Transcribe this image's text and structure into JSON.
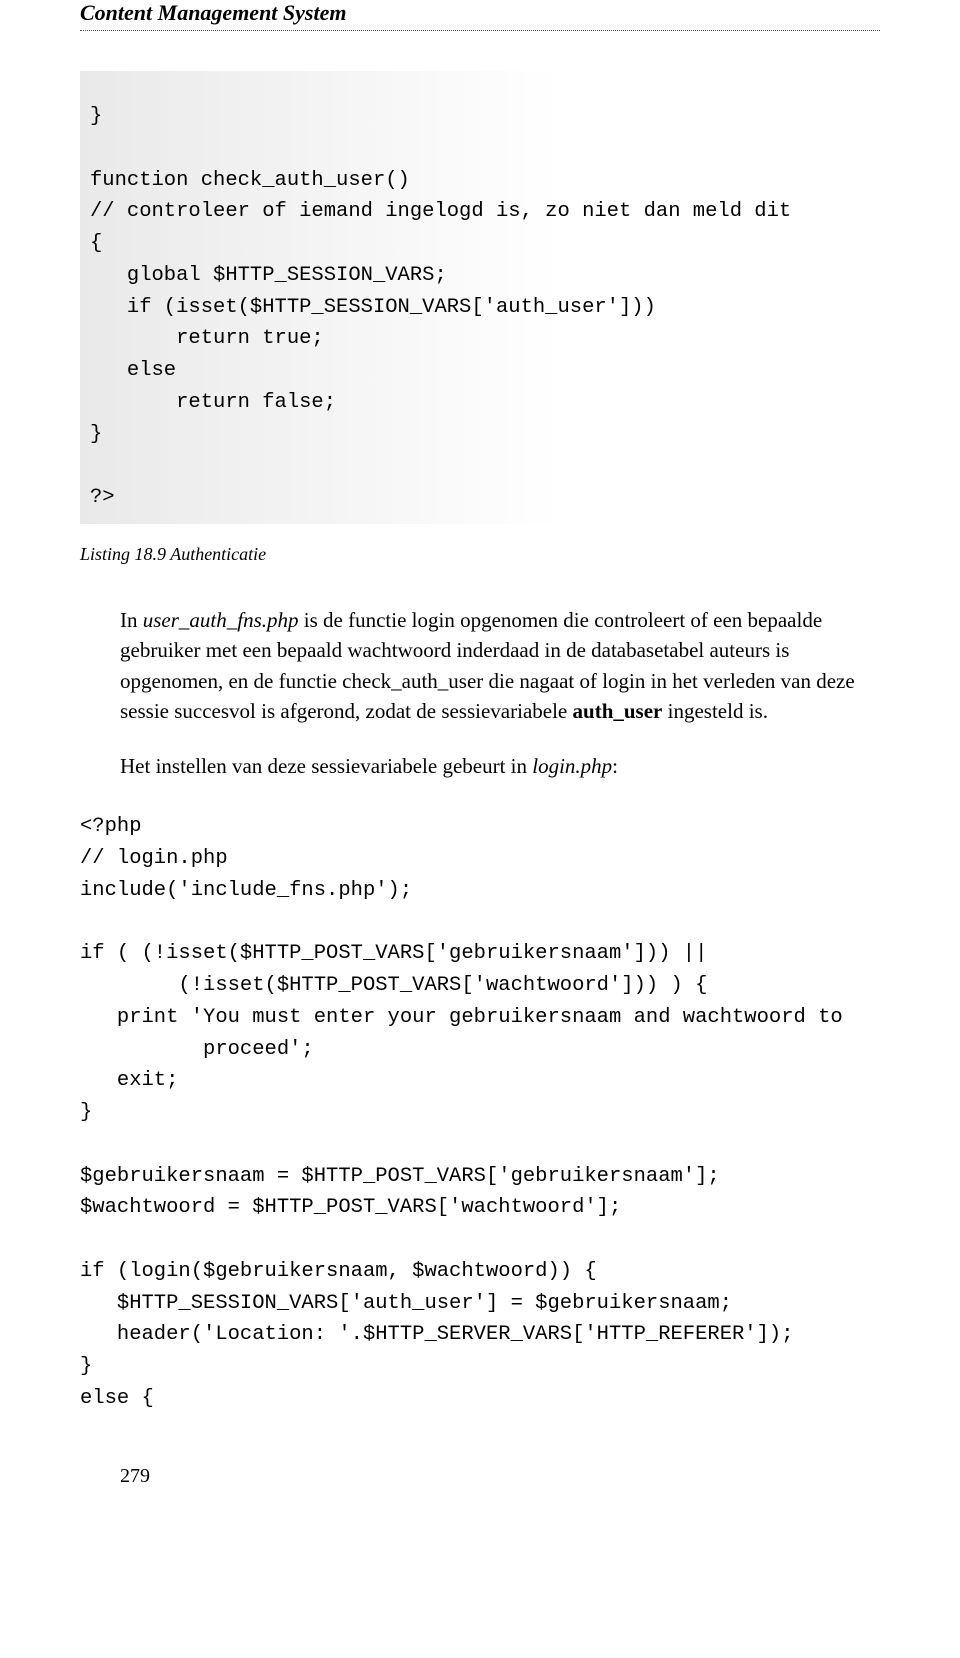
{
  "header": "Content Management System",
  "code1": "}\n\nfunction check_auth_user()\n// controleer of iemand ingelogd is, zo niet dan meld dit\n{\n   global $HTTP_SESSION_VARS;\n   if (isset($HTTP_SESSION_VARS['auth_user']))\n       return true;\n   else\n       return false;\n}\n\n?>",
  "listing_caption": "Listing 18.9 Authenticatie",
  "para1_pre": "In ",
  "para1_em1": "user_auth_fns.php",
  "para1_mid": " is de functie login opgenomen die controleert of een bepaalde gebruiker met een bepaald wachtwoord inderdaad in de databasetabel auteurs is opgenomen, en de functie check_auth_user die nagaat of login in het verleden van deze sessie succesvol is afgerond, zodat de sessievariabele ",
  "para1_strong": "auth_user",
  "para1_end": " ingesteld is.",
  "para2_pre": "Het instellen van deze sessievariabele gebeurt in ",
  "para2_em": "login.php",
  "para2_end": ":",
  "code2": "<?php\n// login.php\ninclude('include_fns.php');\n\nif ( (!isset($HTTP_POST_VARS['gebruikersnaam'])) ||\n        (!isset($HTTP_POST_VARS['wachtwoord'])) ) {\n   print 'You must enter your gebruikersnaam and wachtwoord to\n          proceed';\n   exit;\n}\n\n$gebruikersnaam = $HTTP_POST_VARS['gebruikersnaam'];\n$wachtwoord = $HTTP_POST_VARS['wachtwoord'];\n\nif (login($gebruikersnaam, $wachtwoord)) {\n   $HTTP_SESSION_VARS['auth_user'] = $gebruikersnaam;\n   header('Location: '.$HTTP_SERVER_VARS['HTTP_REFERER']);\n}\nelse {",
  "page_number": "279"
}
